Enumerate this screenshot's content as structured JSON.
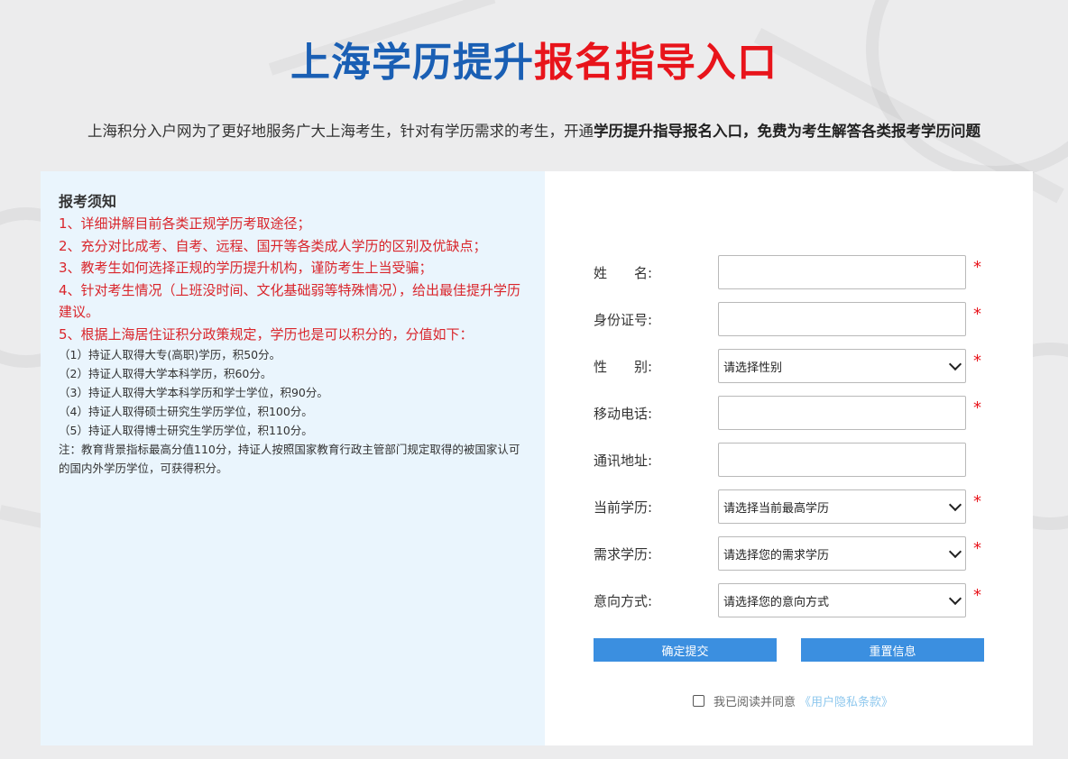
{
  "header": {
    "title_part1": "上海学历提升",
    "title_part2": "报名指导入口",
    "subtitle_plain": "上海积分入户网为了更好地服务广大上海考生，针对有学历需求的考生，开通",
    "subtitle_bold": "学历提升指导报名入口，免费为考生解答各类报考学历问题"
  },
  "notice": {
    "title": "报考须知",
    "red_items": [
      "1、详细讲解目前各类正规学历考取途径；",
      "2、充分对比成考、自考、远程、国开等各类成人学历的区别及优缺点；",
      "3、教考生如何选择正规的学历提升机构，谨防考生上当受骗；",
      "4、针对考生情况（上班没时间、文化基础弱等特殊情况），给出最佳提升学历建议。",
      "5、根据上海居住证积分政策规定，学历也是可以积分的，分值如下："
    ],
    "small_items": [
      "（1）持证人取得大专(高职)学历，积50分。",
      "（2）持证人取得大学本科学历，积60分。",
      "（3）持证人取得大学本科学历和学士学位，积90分。",
      "（4）持证人取得硕士研究生学历学位，积100分。",
      "（5）持证人取得博士研究生学历学位，积110分。",
      "注：教育背景指标最高分值110分，持证人按照国家教育行政主管部门规定取得的被国家认可的国内外学历学位，可获得积分。"
    ]
  },
  "form": {
    "fields": [
      {
        "label": "姓　　名:",
        "type": "input",
        "value": "",
        "required": true
      },
      {
        "label": "身份证号:",
        "type": "input",
        "value": "",
        "required": true
      },
      {
        "label": "性　　别:",
        "type": "select",
        "value": "请选择性别",
        "required": true
      },
      {
        "label": "移动电话:",
        "type": "input",
        "value": "",
        "required": true
      },
      {
        "label": "通讯地址:",
        "type": "input",
        "value": "",
        "required": false
      },
      {
        "label": "当前学历:",
        "type": "select",
        "value": "请选择当前最高学历",
        "required": true
      },
      {
        "label": "需求学历:",
        "type": "select",
        "value": "请选择您的需求学历",
        "required": true
      },
      {
        "label": "意向方式:",
        "type": "select",
        "value": "请选择您的意向方式",
        "required": true
      }
    ],
    "required_mark": "*",
    "submit_label": "确定提交",
    "reset_label": "重置信息",
    "agree_text": "我已阅读并同意",
    "agree_link": "《用户隐私条款》"
  },
  "colors": {
    "title_blue": "#1a5fb4",
    "title_red": "#e8141b",
    "notice_red": "#d9252b",
    "button_blue": "#3b8fe0",
    "notice_bg": "#eaf5fd"
  }
}
